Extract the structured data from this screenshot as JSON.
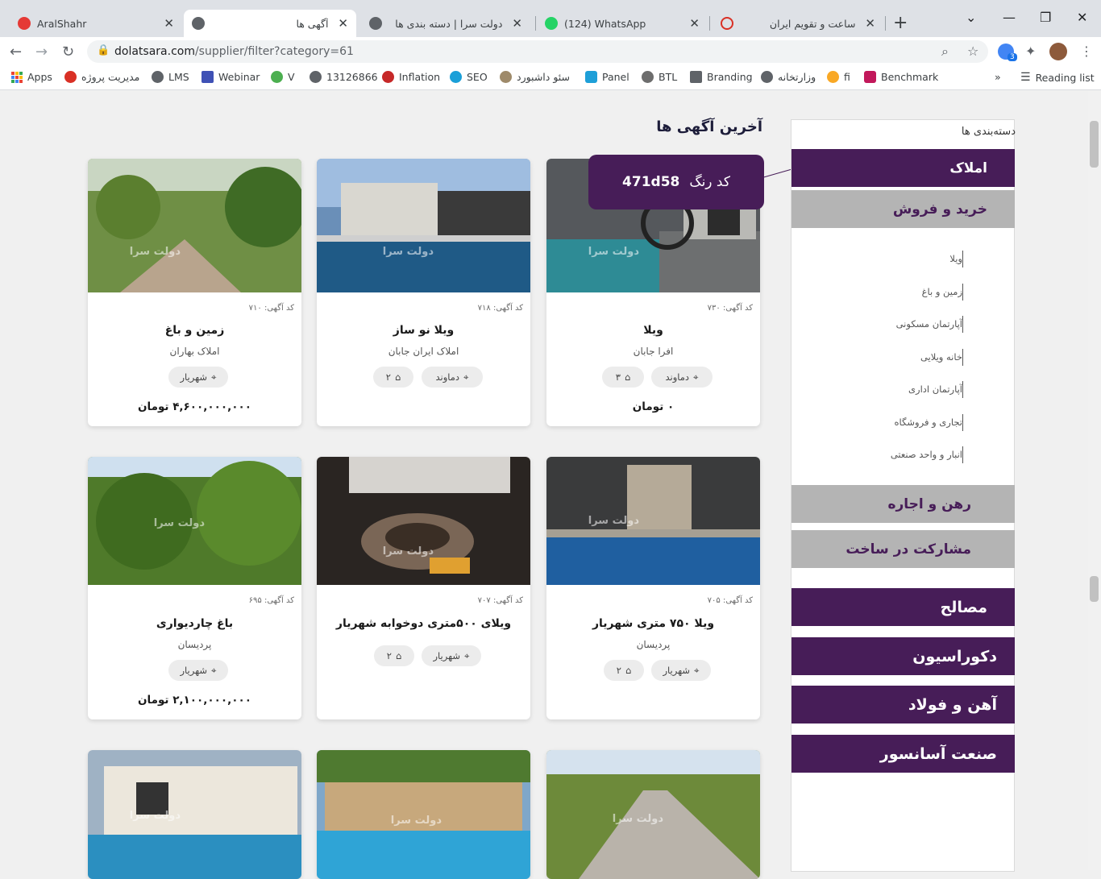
{
  "browser": {
    "tabs": [
      {
        "title": "AralShahr",
        "icon": "aralshahr-icon"
      },
      {
        "title": "آگهی ها",
        "icon": "globe-icon",
        "active": true
      },
      {
        "title": "دولت سرا | دسته بندی ها",
        "icon": "globe-icon"
      },
      {
        "title": "(124) WhatsApp",
        "icon": "whatsapp-icon"
      },
      {
        "title": "ساعت و تقویم ایران",
        "icon": "calendar-check-icon"
      }
    ],
    "url_host": "dolatsara.com",
    "url_path": "/supplier/filter?category=61",
    "extension_badge": "3",
    "bookmarks": [
      {
        "label": "Apps",
        "color": "#ea4335"
      },
      {
        "label": "مدیریت پروژه",
        "color": "#d93025"
      },
      {
        "label": "LMS",
        "color": "#5f6368"
      },
      {
        "label": "Webinar",
        "color": "#3f51b5"
      },
      {
        "label": "V",
        "color": "#4caf50"
      },
      {
        "label": "13126866",
        "color": "#5f6368"
      },
      {
        "label": "Inflation",
        "color": "#c62828"
      },
      {
        "label": "SEO",
        "color": "#1a9fd8"
      },
      {
        "label": "سئو داشبورد",
        "color": "#9e8a6a"
      },
      {
        "label": "Panel",
        "color": "#1e9fd8"
      },
      {
        "label": "BTL",
        "color": "#6d6d6d"
      },
      {
        "label": "Branding",
        "color": "#5f6368"
      },
      {
        "label": "وزارتخانه",
        "color": "#5f6368"
      },
      {
        "label": "fi",
        "color": "#f9a825"
      },
      {
        "label": "Benchmark",
        "color": "#c2185b"
      }
    ],
    "reading_list": "Reading list",
    "overflow_label": "»"
  },
  "page": {
    "section_title": "آخرین آگهی ها",
    "tooltip": {
      "label": "کد رنگ",
      "code": "471d58"
    },
    "brand_color": "#471d58",
    "watermark": "دولت سرا",
    "cards": [
      {
        "code": "کد آگهی: ۷۳۰",
        "title": "ویلا",
        "subtitle": "افرا جابان",
        "location": "دماوند",
        "rooms": "۳",
        "price": "۰ تومان",
        "image": "villa-pool-stairs"
      },
      {
        "code": "کد آگهی: ۷۱۸",
        "title": "ویلا نو ساز",
        "subtitle": "املاک ایران جابان",
        "location": "دماوند",
        "rooms": "۲",
        "price": "",
        "image": "new-villa-pool"
      },
      {
        "code": "کد آگهی: ۷۱۰",
        "title": "زمین و باغ",
        "subtitle": "املاک بهاران",
        "location": "شهریار",
        "rooms": "",
        "price": "۴,۶۰۰,۰۰۰,۰۰۰ تومان",
        "image": "garden-path"
      },
      {
        "code": "کد آگهی: ۷۰۵",
        "title": "ویلا ۷۵۰ متری شهریار",
        "subtitle": "پردیسان",
        "location": "شهریار",
        "rooms": "۲",
        "price": "",
        "image": "night-pool-fireplace"
      },
      {
        "code": "کد آگهی: ۷۰۷",
        "title": "ویلای ۵۰۰متری دوخوابه شهریار",
        "subtitle": "",
        "location": "شهریار",
        "rooms": "۲",
        "price": "",
        "image": "night-firepit"
      },
      {
        "code": "کد آگهی: ۶۹۵",
        "title": "باغ چاردیواری",
        "subtitle": "پردیسان",
        "location": "شهریار",
        "rooms": "",
        "price": "۲,۱۰۰,۰۰۰,۰۰۰ تومان",
        "image": "green-trees"
      },
      {
        "image": "gravel-road-trees"
      },
      {
        "image": "villa-pool-day"
      },
      {
        "image": "white-villa-pool"
      }
    ]
  },
  "sidebar": {
    "heading": "دسته‌بندی ها",
    "cat_real_estate": "املاک",
    "cat_buy_sell": "خرید و فروش",
    "subcategories": [
      "ویلا",
      "زمین و باغ",
      "آپارتمان مسکونی",
      "خانه ویلایی",
      "آپارتمان اداری",
      "تجاری و فروشگاه",
      "انبار و واحد صنعتی"
    ],
    "cat_rent": "رهن و اجاره",
    "cat_partnership": "مشارکت در ساخت",
    "cat_materials": "مصالح",
    "cat_decoration": "دکوراسیون",
    "cat_steel": "آهن و فولاد",
    "cat_elevator": "صنعت آسانسور"
  }
}
